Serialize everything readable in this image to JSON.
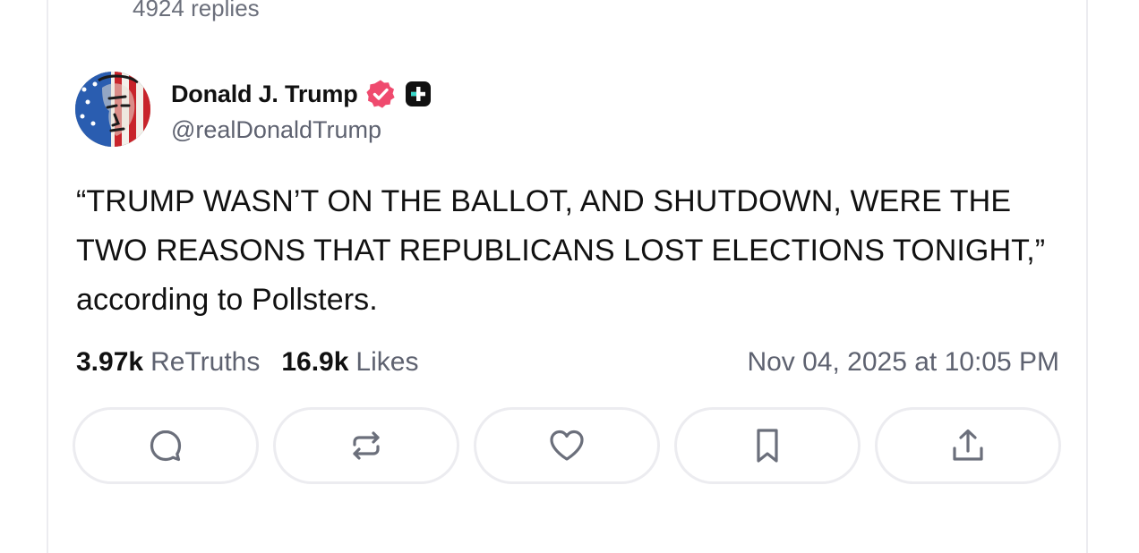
{
  "thread": {
    "replies_count_label": "4924 replies"
  },
  "post": {
    "author": {
      "display_name": "Donald J. Trump",
      "handle": "@realDonaldTrump",
      "verified_badge_color": "#ef4a6e",
      "plus_badge_color": "#111111"
    },
    "text": "“TRUMP WASN’T ON THE BALLOT, AND SHUTDOWN, WERE THE TWO REASONS THAT REPUBLICANS LOST ELECTIONS TONIGHT,” according to Pollsters.",
    "stats": {
      "retruths_count": "3.97k",
      "retruths_label": "ReTruths",
      "likes_count": "16.9k",
      "likes_label": "Likes"
    },
    "timestamp": "Nov 04, 2025 at 10:05 PM"
  },
  "actions": [
    {
      "name": "reply",
      "icon": "comment-icon"
    },
    {
      "name": "retruth",
      "icon": "repost-icon"
    },
    {
      "name": "like",
      "icon": "heart-icon"
    },
    {
      "name": "bookmark",
      "icon": "bookmark-icon"
    },
    {
      "name": "share",
      "icon": "share-icon"
    }
  ],
  "colors": {
    "primary_text": "#111111",
    "secondary_text": "#5e6270",
    "border": "#ececf0",
    "icon": "#6b6f7b"
  }
}
